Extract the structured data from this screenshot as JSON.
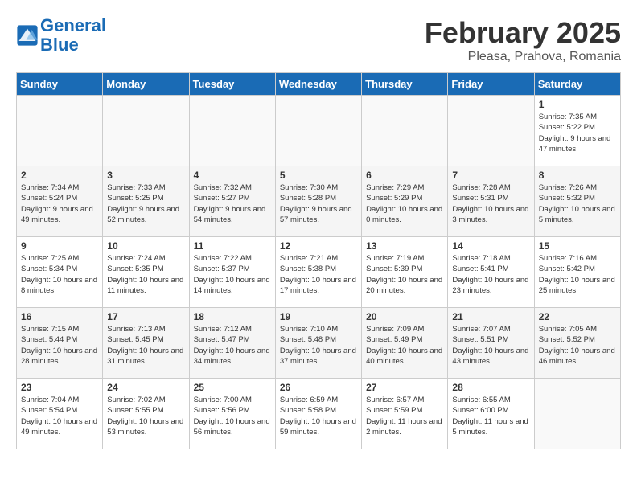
{
  "header": {
    "logo_line1": "General",
    "logo_line2": "Blue",
    "title": "February 2025",
    "subtitle": "Pleasa, Prahova, Romania"
  },
  "weekdays": [
    "Sunday",
    "Monday",
    "Tuesday",
    "Wednesday",
    "Thursday",
    "Friday",
    "Saturday"
  ],
  "weeks": [
    [
      {
        "day": "",
        "info": ""
      },
      {
        "day": "",
        "info": ""
      },
      {
        "day": "",
        "info": ""
      },
      {
        "day": "",
        "info": ""
      },
      {
        "day": "",
        "info": ""
      },
      {
        "day": "",
        "info": ""
      },
      {
        "day": "1",
        "info": "Sunrise: 7:35 AM\nSunset: 5:22 PM\nDaylight: 9 hours and 47 minutes."
      }
    ],
    [
      {
        "day": "2",
        "info": "Sunrise: 7:34 AM\nSunset: 5:24 PM\nDaylight: 9 hours and 49 minutes."
      },
      {
        "day": "3",
        "info": "Sunrise: 7:33 AM\nSunset: 5:25 PM\nDaylight: 9 hours and 52 minutes."
      },
      {
        "day": "4",
        "info": "Sunrise: 7:32 AM\nSunset: 5:27 PM\nDaylight: 9 hours and 54 minutes."
      },
      {
        "day": "5",
        "info": "Sunrise: 7:30 AM\nSunset: 5:28 PM\nDaylight: 9 hours and 57 minutes."
      },
      {
        "day": "6",
        "info": "Sunrise: 7:29 AM\nSunset: 5:29 PM\nDaylight: 10 hours and 0 minutes."
      },
      {
        "day": "7",
        "info": "Sunrise: 7:28 AM\nSunset: 5:31 PM\nDaylight: 10 hours and 3 minutes."
      },
      {
        "day": "8",
        "info": "Sunrise: 7:26 AM\nSunset: 5:32 PM\nDaylight: 10 hours and 5 minutes."
      }
    ],
    [
      {
        "day": "9",
        "info": "Sunrise: 7:25 AM\nSunset: 5:34 PM\nDaylight: 10 hours and 8 minutes."
      },
      {
        "day": "10",
        "info": "Sunrise: 7:24 AM\nSunset: 5:35 PM\nDaylight: 10 hours and 11 minutes."
      },
      {
        "day": "11",
        "info": "Sunrise: 7:22 AM\nSunset: 5:37 PM\nDaylight: 10 hours and 14 minutes."
      },
      {
        "day": "12",
        "info": "Sunrise: 7:21 AM\nSunset: 5:38 PM\nDaylight: 10 hours and 17 minutes."
      },
      {
        "day": "13",
        "info": "Sunrise: 7:19 AM\nSunset: 5:39 PM\nDaylight: 10 hours and 20 minutes."
      },
      {
        "day": "14",
        "info": "Sunrise: 7:18 AM\nSunset: 5:41 PM\nDaylight: 10 hours and 23 minutes."
      },
      {
        "day": "15",
        "info": "Sunrise: 7:16 AM\nSunset: 5:42 PM\nDaylight: 10 hours and 25 minutes."
      }
    ],
    [
      {
        "day": "16",
        "info": "Sunrise: 7:15 AM\nSunset: 5:44 PM\nDaylight: 10 hours and 28 minutes."
      },
      {
        "day": "17",
        "info": "Sunrise: 7:13 AM\nSunset: 5:45 PM\nDaylight: 10 hours and 31 minutes."
      },
      {
        "day": "18",
        "info": "Sunrise: 7:12 AM\nSunset: 5:47 PM\nDaylight: 10 hours and 34 minutes."
      },
      {
        "day": "19",
        "info": "Sunrise: 7:10 AM\nSunset: 5:48 PM\nDaylight: 10 hours and 37 minutes."
      },
      {
        "day": "20",
        "info": "Sunrise: 7:09 AM\nSunset: 5:49 PM\nDaylight: 10 hours and 40 minutes."
      },
      {
        "day": "21",
        "info": "Sunrise: 7:07 AM\nSunset: 5:51 PM\nDaylight: 10 hours and 43 minutes."
      },
      {
        "day": "22",
        "info": "Sunrise: 7:05 AM\nSunset: 5:52 PM\nDaylight: 10 hours and 46 minutes."
      }
    ],
    [
      {
        "day": "23",
        "info": "Sunrise: 7:04 AM\nSunset: 5:54 PM\nDaylight: 10 hours and 49 minutes."
      },
      {
        "day": "24",
        "info": "Sunrise: 7:02 AM\nSunset: 5:55 PM\nDaylight: 10 hours and 53 minutes."
      },
      {
        "day": "25",
        "info": "Sunrise: 7:00 AM\nSunset: 5:56 PM\nDaylight: 10 hours and 56 minutes."
      },
      {
        "day": "26",
        "info": "Sunrise: 6:59 AM\nSunset: 5:58 PM\nDaylight: 10 hours and 59 minutes."
      },
      {
        "day": "27",
        "info": "Sunrise: 6:57 AM\nSunset: 5:59 PM\nDaylight: 11 hours and 2 minutes."
      },
      {
        "day": "28",
        "info": "Sunrise: 6:55 AM\nSunset: 6:00 PM\nDaylight: 11 hours and 5 minutes."
      },
      {
        "day": "",
        "info": ""
      }
    ]
  ]
}
